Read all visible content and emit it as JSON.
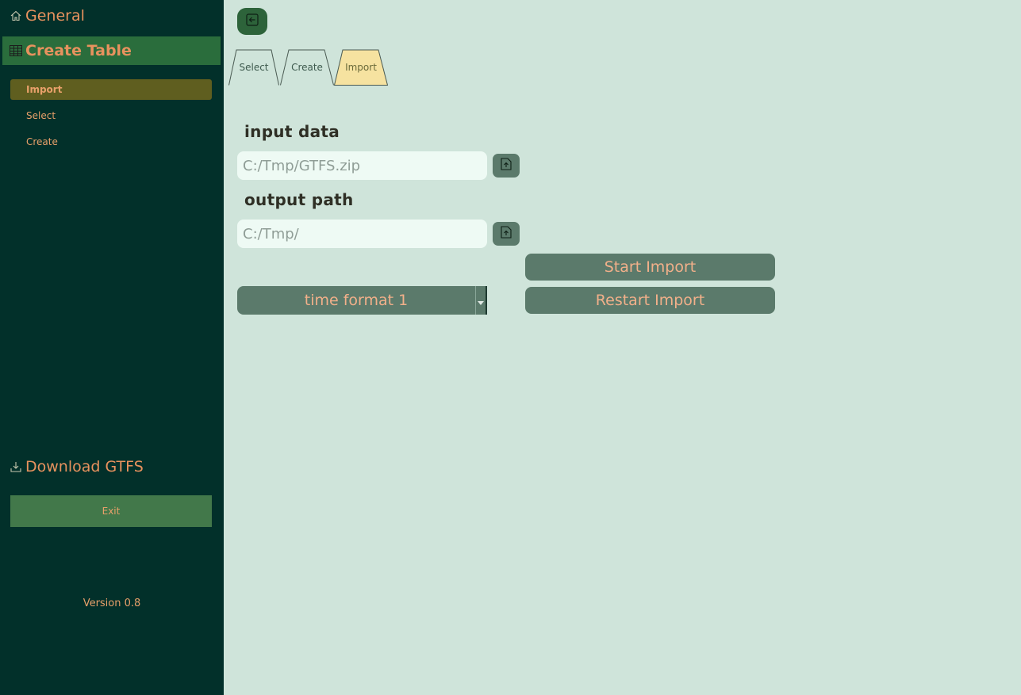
{
  "sidebar": {
    "general_label": "General",
    "create_table_label": "Create Table",
    "sub_items": [
      {
        "label": "Import"
      },
      {
        "label": "Select"
      },
      {
        "label": "Create"
      }
    ],
    "download_label": "Download GTFS",
    "exit_label": "Exit",
    "version": "Version 0.8"
  },
  "tabs": [
    {
      "label": "Select"
    },
    {
      "label": "Create"
    },
    {
      "label": "Import",
      "active": true
    }
  ],
  "form": {
    "input_label": "input data",
    "input_placeholder": "C:/Tmp/GTFS.zip",
    "output_label": "output path",
    "output_placeholder": "C:/Tmp/",
    "time_format_selected": "time format 1",
    "start_label": "Start Import",
    "restart_label": "Restart Import"
  },
  "colors": {
    "sidebar_bg": "#02302a",
    "accent_text": "#e8925e",
    "selected_nav": "#2a6d3c",
    "active_subitem": "#5f5e1f",
    "main_bg": "#cfe4da",
    "button_bg": "#5b7a6b",
    "active_tab": "#f6e2a0"
  },
  "icons": {
    "general": "home-icon",
    "create_table": "table-icon",
    "download": "download-icon",
    "back": "back-arrow-icon",
    "file_upload": "file-upload-icon",
    "dropdown": "chevron-down-icon"
  }
}
